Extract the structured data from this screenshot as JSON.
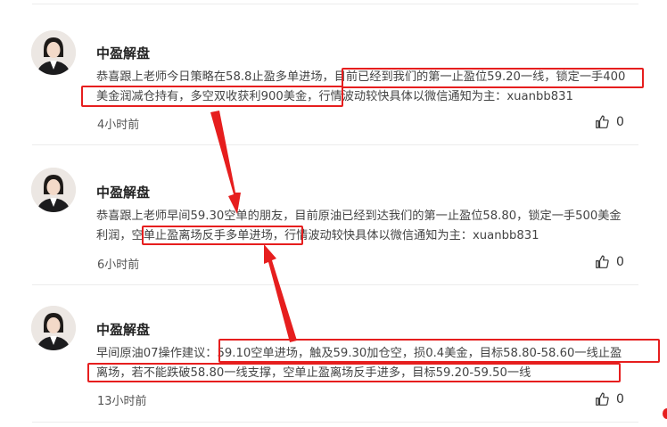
{
  "posts": [
    {
      "author": "中盈解盘",
      "text": "恭喜跟上老师今日策略在58.8止盈多单进场，目前已经到我们的第一止盈位59.20一线，锁定一手400美金润减仓持有，多空双收获利900美金，行情波动较快具体以微信通知为主：xuanbb831",
      "time": "4小时前",
      "likes": "0"
    },
    {
      "author": "中盈解盘",
      "text": "恭喜跟上老师早间59.30空单的朋友，目前原油已经到达我们的第一止盈位58.80，锁定一手500美金利润，空单止盈离场反手多单进场，行情波动较快具体以微信通知为主：xuanbb831",
      "time": "6小时前",
      "likes": "0"
    },
    {
      "author": "中盈解盘",
      "text": "早间原油07操作建议：59.10空单进场，触及59.30加仓空，损0.4美金，目标58.80-58.60一线止盈离场，若不能跌破58.80一线支撑，空单止盈离场反手进多，目标59.20-59.50一线",
      "time": "13小时前",
      "likes": "0"
    }
  ],
  "colors": {
    "highlight": "#e61e1e",
    "divider": "#ececec"
  },
  "icons": {
    "like": "thumbs-up-icon",
    "avatar": "user-avatar"
  }
}
